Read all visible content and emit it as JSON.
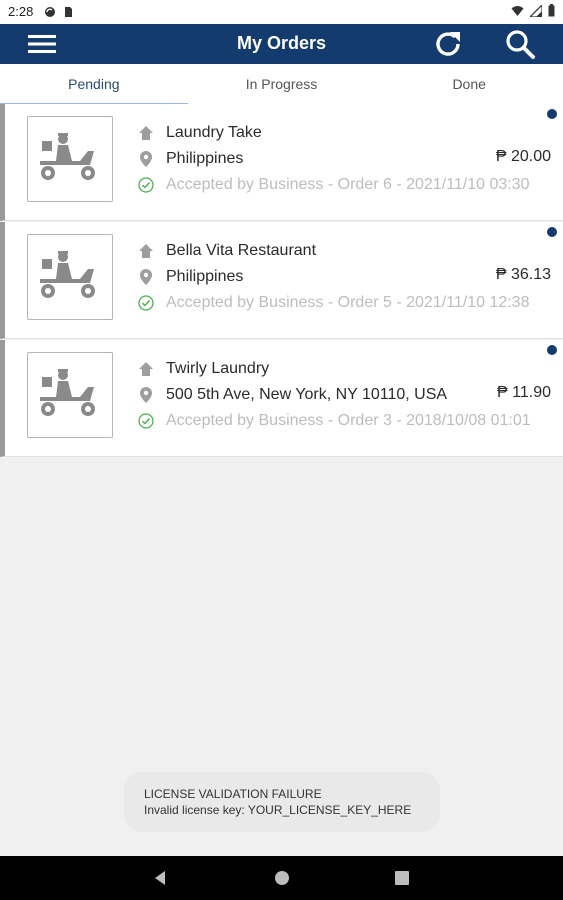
{
  "status_bar": {
    "time": "2:28"
  },
  "app_bar": {
    "title": "My Orders",
    "icons": [
      "menu-icon",
      "refresh-icon",
      "search-icon"
    ]
  },
  "tabs": [
    {
      "label": "Pending",
      "active": true
    },
    {
      "label": "In Progress",
      "active": false
    },
    {
      "label": "Done",
      "active": false
    }
  ],
  "orders": [
    {
      "business": "Laundry Take",
      "location": "Philippines",
      "price": "₱ 20.00",
      "status": "Accepted by Business - Order 6 - 2021/11/10 03:30"
    },
    {
      "business": "Bella Vita Restaurant",
      "location": "Philippines",
      "price": "₱ 36.13",
      "status": "Accepted by Business - Order 5 - 2021/11/10 12:38"
    },
    {
      "business": "Twirly Laundry",
      "location": "500 5th Ave, New York, NY 10110, USA",
      "price": "₱ 11.90",
      "status": "Accepted by Business - Order 3 - 2018/10/08 01:01"
    }
  ],
  "toast": {
    "line1": "LICENSE VALIDATION FAILURE",
    "line2": "Invalid license key: YOUR_LICENSE_KEY_HERE"
  },
  "colors": {
    "primary": "#133b6e",
    "accent_tab": "#9db7e0",
    "status_green": "#4caf50",
    "muted_text": "#bdbdbd"
  }
}
